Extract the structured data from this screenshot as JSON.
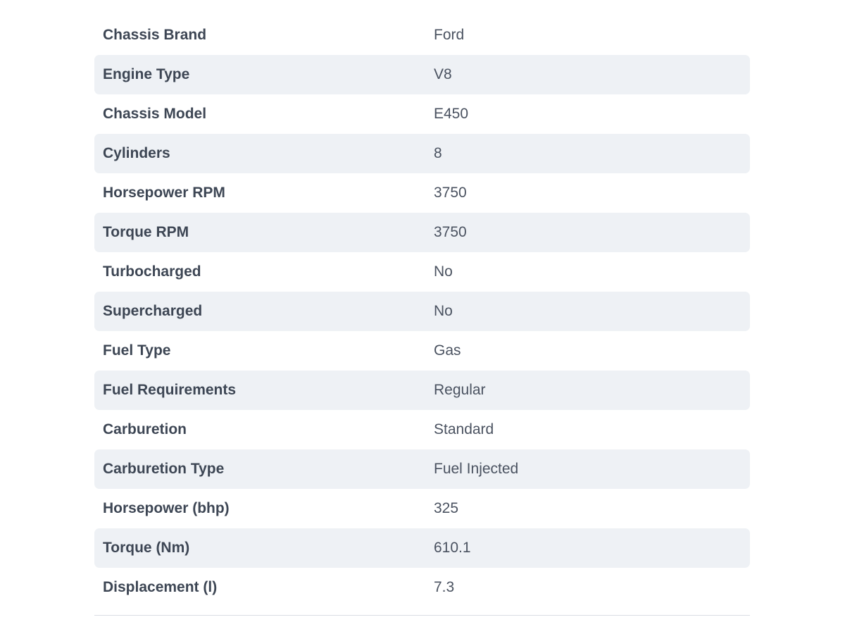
{
  "specs": [
    {
      "label": "Chassis Brand",
      "value": "Ford"
    },
    {
      "label": "Engine Type",
      "value": "V8"
    },
    {
      "label": "Chassis Model",
      "value": "E450"
    },
    {
      "label": "Cylinders",
      "value": "8"
    },
    {
      "label": "Horsepower RPM",
      "value": "3750"
    },
    {
      "label": "Torque RPM",
      "value": "3750"
    },
    {
      "label": "Turbocharged",
      "value": "No"
    },
    {
      "label": "Supercharged",
      "value": "No"
    },
    {
      "label": "Fuel Type",
      "value": "Gas"
    },
    {
      "label": "Fuel Requirements",
      "value": "Regular"
    },
    {
      "label": "Carburetion",
      "value": "Standard"
    },
    {
      "label": "Carburetion Type",
      "value": "Fuel Injected"
    },
    {
      "label": "Horsepower (bhp)",
      "value": "325"
    },
    {
      "label": "Torque (Nm)",
      "value": "610.1"
    },
    {
      "label": "Displacement (l)",
      "value": "7.3"
    }
  ],
  "colors": {
    "row_alt_bg": "#eef1f5",
    "label_text": "#3d4654",
    "value_text": "#4a5260",
    "divider": "#d9dde3"
  }
}
